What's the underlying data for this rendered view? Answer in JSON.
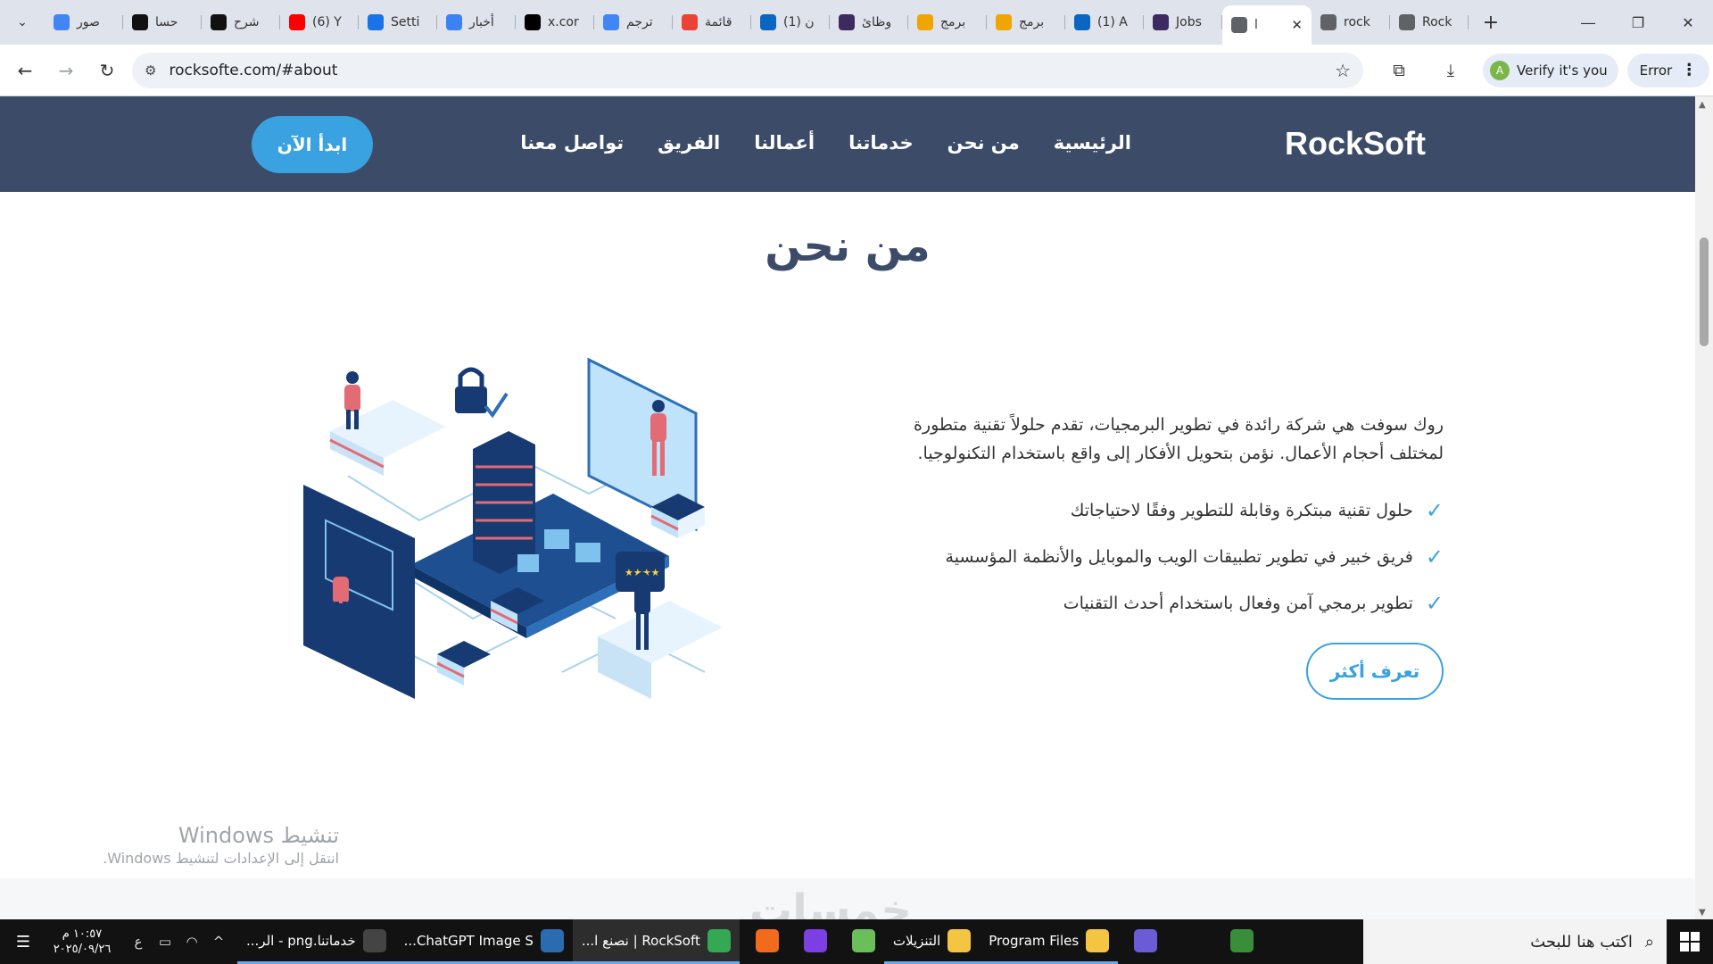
{
  "browser": {
    "tabs": [
      {
        "label": "صور",
        "favicon": "google-icon",
        "color": "#4285f4"
      },
      {
        "label": "حسا",
        "favicon": "threads-icon",
        "color": "#111111"
      },
      {
        "label": "شرح",
        "favicon": "openai-icon",
        "color": "#111111"
      },
      {
        "label": "(6) Y",
        "favicon": "youtube-icon",
        "color": "#ff0000"
      },
      {
        "label": "Setti",
        "favicon": "settings-icon",
        "color": "#1a73e8"
      },
      {
        "label": "أخبار",
        "favicon": "news-icon",
        "color": "#3b82f6"
      },
      {
        "label": "x.cor",
        "favicon": "x-icon",
        "color": "#000000"
      },
      {
        "label": "ترجم",
        "favicon": "translate-icon",
        "color": "#4285f4"
      },
      {
        "label": "قائمة",
        "favicon": "gmail-icon",
        "color": "#ea4335"
      },
      {
        "label": "(1) ن",
        "favicon": "linkedin-icon",
        "color": "#0a66c2"
      },
      {
        "label": "وظائ",
        "favicon": "wuzzuf-icon",
        "color": "#3d2b5f"
      },
      {
        "label": "برمج",
        "favicon": "khamsat-icon",
        "color": "#f0a500"
      },
      {
        "label": "برمج",
        "favicon": "khamsat-icon",
        "color": "#f0a500"
      },
      {
        "label": "(1) A",
        "favicon": "linkedin-icon",
        "color": "#0a66c2"
      },
      {
        "label": "Jobs",
        "favicon": "wuzzuf-icon",
        "color": "#3d2b5f"
      },
      {
        "label": "l",
        "favicon": "globe-icon",
        "color": "#5f6368",
        "active": true
      },
      {
        "label": "rock",
        "favicon": "globe-icon",
        "color": "#5f6368"
      },
      {
        "label": "Rock",
        "favicon": "globe-icon",
        "color": "#5f6368"
      }
    ],
    "url": "rocksofte.com/#about",
    "verify_label": "Verify it's you",
    "verify_avatar": "A",
    "error_label": "Error"
  },
  "site": {
    "logo": "RockSoft",
    "menu": [
      "الرئيسية",
      "من نحن",
      "خدماتنا",
      "أعمالنا",
      "الفريق",
      "تواصل معنا"
    ],
    "cta_label": "ابدأ الآن",
    "accent": "#3aa2e0",
    "nav_bg": "#3b4b68"
  },
  "about": {
    "title": "من نحن",
    "description": "روك سوفت هي شركة رائدة في تطوير البرمجيات، تقدم حلولاً تقنية متطورة لمختلف أحجام الأعمال. نؤمن بتحويل الأفكار إلى واقع باستخدام التكنولوجيا.",
    "features": [
      "حلول تقنية مبتكرة وقابلة للتطوير وفقًا لاحتياجاتك",
      "فريق خبير في تطوير تطبيقات الويب والموبايل والأنظمة المؤسسية",
      "تطوير برمجي آمن وفعال باستخدام أحدث التقنيات"
    ],
    "learn_more": "تعرف أكثر"
  },
  "windows_activation": {
    "title": "تنشيط Windows",
    "subtitle": "انتقل إلى الإعدادات لتنشيط Windows."
  },
  "watermark": "خمسات",
  "taskbar": {
    "time": "١٠:٥٧ م",
    "date": "٢٠٢٥/٠٩/٢٦",
    "lang": "ع",
    "tasks": [
      {
        "label": "خدماتنا.png - الر...",
        "icon": "paint-icon",
        "color": "#444444"
      },
      {
        "label": "ChatGPT Image S...",
        "icon": "photos-icon",
        "color": "#2b6cb0"
      },
      {
        "label": "RockSoft | نصنع ا...",
        "icon": "chrome-icon",
        "color": "#34a853",
        "active": true
      },
      {
        "label": "",
        "icon": "xampp-icon",
        "color": "#f26b1d"
      },
      {
        "label": "",
        "icon": "phpstorm-icon",
        "color": "#7b3fe4"
      },
      {
        "label": "",
        "icon": "git-icon",
        "color": "#6bbf59"
      },
      {
        "label": "التنزيلات",
        "icon": "folder-download-icon",
        "color": "#f4c542"
      },
      {
        "label": "Program Files",
        "icon": "folder-icon",
        "color": "#f4c542"
      },
      {
        "label": "",
        "icon": "copilot-icon",
        "color": "#6b5bd6"
      },
      {
        "label": "",
        "icon": "task-view-icon",
        "color": "#121212"
      },
      {
        "label": "",
        "icon": "golf-icon",
        "color": "#3a8e3a"
      }
    ],
    "search_placeholder": "اكتب هنا للبحث"
  }
}
